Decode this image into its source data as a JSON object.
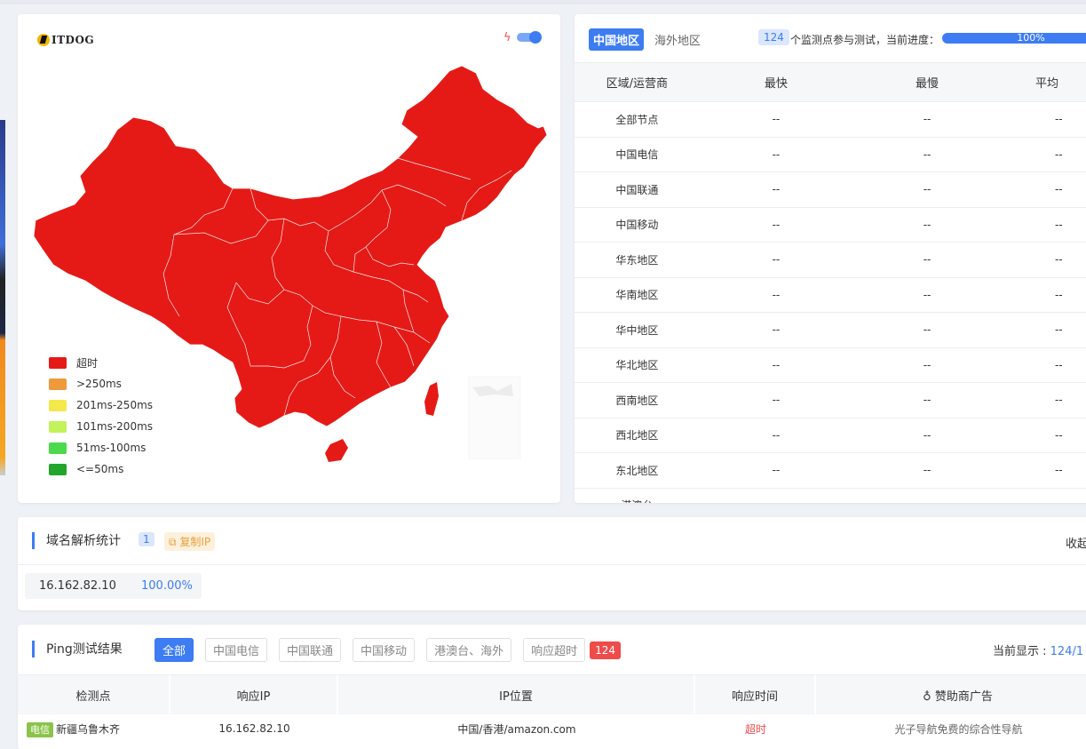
{
  "map": {
    "logo_text": "ITDOG",
    "legend": [
      {
        "label": "超时",
        "color": "#e51a17"
      },
      {
        "label": ">250ms",
        "color": "#f0993a"
      },
      {
        "label": "201ms-250ms",
        "color": "#f4e84a"
      },
      {
        "label": "101ms-200ms",
        "color": "#c3f25a"
      },
      {
        "label": "51ms-100ms",
        "color": "#4cd94c"
      },
      {
        "label": "<=50ms",
        "color": "#22a52a"
      }
    ],
    "fill_color": "#e51a17"
  },
  "stats": {
    "tabs": [
      "中国地区",
      "海外地区"
    ],
    "node_count": "124",
    "progress_label": "个监测点参与测试，当前进度：",
    "progress_value": "100%",
    "columns": [
      "区域/运营商",
      "最快",
      "最慢",
      "平均"
    ],
    "rows": [
      [
        "全部节点",
        "--",
        "--",
        "--"
      ],
      [
        "中国电信",
        "--",
        "--",
        "--"
      ],
      [
        "中国联通",
        "--",
        "--",
        "--"
      ],
      [
        "中国移动",
        "--",
        "--",
        "--"
      ],
      [
        "华东地区",
        "--",
        "--",
        "--"
      ],
      [
        "华南地区",
        "--",
        "--",
        "--"
      ],
      [
        "华中地区",
        "--",
        "--",
        "--"
      ],
      [
        "华北地区",
        "--",
        "--",
        "--"
      ],
      [
        "西南地区",
        "--",
        "--",
        "--"
      ],
      [
        "西北地区",
        "--",
        "--",
        "--"
      ],
      [
        "东北地区",
        "--",
        "--",
        "--"
      ],
      [
        "港澳台",
        "--",
        "--",
        "--"
      ]
    ]
  },
  "dns": {
    "title": "域名解析统计",
    "count": "1",
    "copy_label": "复制IP",
    "collapse_label": "收起",
    "entries": [
      {
        "ip": "16.162.82.10",
        "percent": "100.00%"
      }
    ]
  },
  "ping": {
    "title": "Ping测试结果",
    "filters": [
      "全部",
      "中国电信",
      "中国联通",
      "中国移动",
      "港澳台、海外",
      "响应超时"
    ],
    "timeout_count": "124",
    "showing_label": "当前显示 : ",
    "showing_value": "124/1",
    "columns": [
      "检测点",
      "响应IP",
      "IP位置",
      "响应时间",
      "赞助商广告"
    ],
    "rows": [
      {
        "isp": "电信",
        "node": "新疆乌鲁木齐",
        "ip": "16.162.82.10",
        "location": "中国/香港/amazon.com",
        "time": "超时",
        "ad": "光子导航免费的综合性导航"
      }
    ]
  }
}
